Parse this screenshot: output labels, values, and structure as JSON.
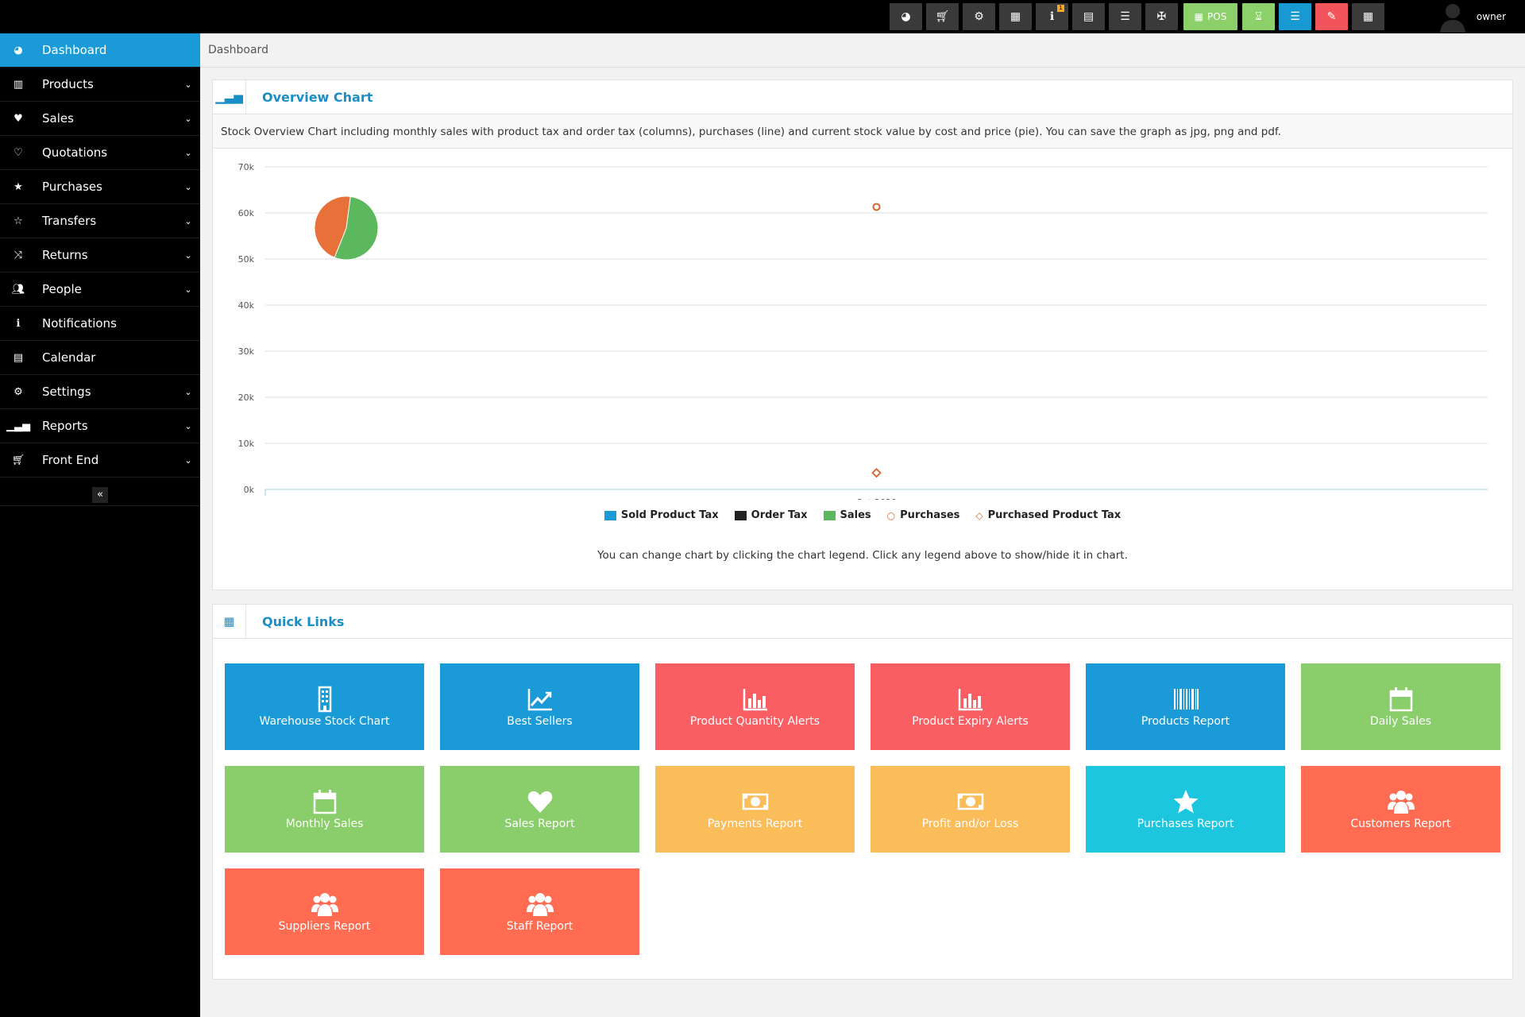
{
  "topbar": {
    "buttons": [
      {
        "name": "dashboard-icon",
        "glyph": "◕"
      },
      {
        "name": "cart-icon",
        "glyph": "🛒︎"
      },
      {
        "name": "cogs-icon",
        "glyph": "⚙"
      },
      {
        "name": "calculator-icon",
        "glyph": "▦"
      },
      {
        "name": "info-icon",
        "glyph": "ℹ",
        "badge": "1"
      },
      {
        "name": "calendar-icon",
        "glyph": "▤"
      },
      {
        "name": "stack-icon",
        "glyph": "☰"
      },
      {
        "name": "flag-uk-icon",
        "glyph": "✠"
      }
    ],
    "pos_label": "POS",
    "user_name": "owner"
  },
  "sidebar": {
    "items": [
      {
        "label": "Dashboard",
        "icon": "dashboard-icon",
        "glyph": "◕",
        "active": true,
        "chevron": false
      },
      {
        "label": "Products",
        "icon": "barcode-icon",
        "glyph": "▥",
        "chevron": true
      },
      {
        "label": "Sales",
        "icon": "heart-icon",
        "glyph": "♥",
        "chevron": true
      },
      {
        "label": "Quotations",
        "icon": "heart-outline-icon",
        "glyph": "♡",
        "chevron": true
      },
      {
        "label": "Purchases",
        "icon": "star-icon",
        "glyph": "★",
        "chevron": true
      },
      {
        "label": "Transfers",
        "icon": "star-outline-icon",
        "glyph": "☆",
        "chevron": true
      },
      {
        "label": "Returns",
        "icon": "random-icon",
        "glyph": "⤨",
        "chevron": true
      },
      {
        "label": "People",
        "icon": "users-icon",
        "glyph": "👥︎",
        "chevron": true
      },
      {
        "label": "Notifications",
        "icon": "info-circle-icon",
        "glyph": "ℹ",
        "chevron": false
      },
      {
        "label": "Calendar",
        "icon": "calendar-icon",
        "glyph": "▤",
        "chevron": false
      },
      {
        "label": "Settings",
        "icon": "cog-icon",
        "glyph": "⚙",
        "chevron": true
      },
      {
        "label": "Reports",
        "icon": "bar-chart-icon",
        "glyph": "▁▃▅",
        "chevron": true
      },
      {
        "label": "Front End",
        "icon": "cart-icon",
        "glyph": "🛒︎",
        "chevron": true
      }
    ],
    "collapse_glyph": "«"
  },
  "breadcrumb": "Dashboard",
  "overview": {
    "title": "Overview Chart",
    "description": "Stock Overview Chart including monthly sales with product tax and order tax (columns), purchases (line) and current stock value by cost and price (pie). You can save the graph as jpg, png and pdf.",
    "note": "You can change chart by clicking the chart legend. Click any legend above to show/hide it in chart."
  },
  "chart_data": {
    "type": "line",
    "categories": [
      "Oct-2020"
    ],
    "y_ticks": [
      "0k",
      "10k",
      "20k",
      "30k",
      "40k",
      "50k",
      "60k",
      "70k"
    ],
    "ylim": [
      0,
      70000
    ],
    "series": [
      {
        "name": "Sold Product Tax",
        "kind": "column",
        "values": [
          0
        ],
        "color": "#1a9bd7"
      },
      {
        "name": "Order Tax",
        "kind": "column",
        "values": [
          0
        ],
        "color": "#222222"
      },
      {
        "name": "Sales",
        "kind": "column",
        "values": [
          0
        ],
        "color": "#5cb85c"
      },
      {
        "name": "Purchases",
        "kind": "line",
        "values": [
          61300
        ],
        "color": "#d9632a"
      },
      {
        "name": "Purchased Product Tax",
        "kind": "line",
        "values": [
          3600
        ],
        "color": "#d9632a"
      }
    ],
    "pie": {
      "slices": [
        {
          "value": 54,
          "color": "#5cb85c"
        },
        {
          "value": 46,
          "color": "#e8713a"
        }
      ]
    },
    "grid": true,
    "legend_position": "bottom"
  },
  "quick_links": {
    "title": "Quick Links",
    "tiles": [
      {
        "label": "Warehouse Stock Chart",
        "icon": "building-icon",
        "color": "blue"
      },
      {
        "label": "Best Sellers",
        "icon": "line-chart-icon",
        "color": "blue"
      },
      {
        "label": "Product Quantity Alerts",
        "icon": "bar-chart-icon",
        "color": "red"
      },
      {
        "label": "Product Expiry Alerts",
        "icon": "bar-chart-icon",
        "color": "red"
      },
      {
        "label": "Products Report",
        "icon": "barcode-icon",
        "color": "blue"
      },
      {
        "label": "Daily Sales",
        "icon": "calendar-icon",
        "color": "green"
      },
      {
        "label": "Monthly Sales",
        "icon": "calendar-icon",
        "color": "green"
      },
      {
        "label": "Sales Report",
        "icon": "heart-icon",
        "color": "green"
      },
      {
        "label": "Payments Report",
        "icon": "money-icon",
        "color": "orange"
      },
      {
        "label": "Profit and/or Loss",
        "icon": "money-icon",
        "color": "orange"
      },
      {
        "label": "Purchases Report",
        "icon": "star-icon",
        "color": "cyan"
      },
      {
        "label": "Customers Report",
        "icon": "users-icon",
        "color": "coral"
      },
      {
        "label": "Suppliers Report",
        "icon": "users-icon",
        "color": "coral"
      },
      {
        "label": "Staff Report",
        "icon": "users-icon",
        "color": "coral"
      }
    ]
  }
}
